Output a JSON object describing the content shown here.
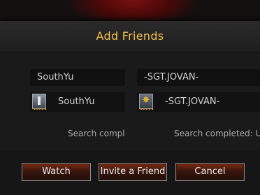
{
  "dialog": {
    "title": "Add Friends"
  },
  "search": {
    "left_query": "SouthYu",
    "right_query": "-SGT.JOVAN-"
  },
  "results": [
    {
      "name": "SouthYu",
      "rank_icon": "private-rank-icon",
      "status": "Search compl"
    },
    {
      "name": "-SGT.JOVAN-",
      "rank_icon": "star-rank-icon",
      "status": "Search completed: U"
    }
  ],
  "buttons": {
    "watch": "Watch",
    "invite": "Invite a Friend",
    "cancel": "Cancel"
  },
  "colors": {
    "title": "#f2c14b",
    "button_top": "#7a2a12",
    "rank_stripes": "#d4a418"
  }
}
